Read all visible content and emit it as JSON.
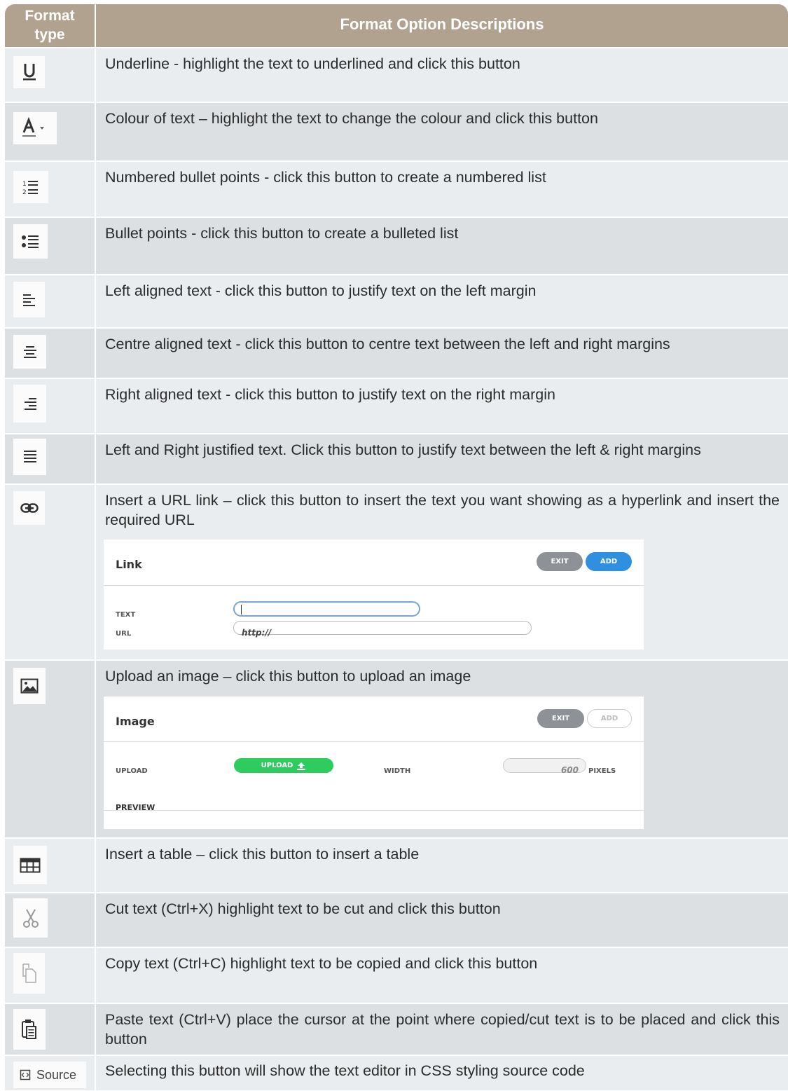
{
  "header": {
    "col1": "Format type",
    "col1_line1": "Format",
    "col1_line2": "type",
    "col2": "Format Option Descriptions"
  },
  "rows": [
    {
      "icon": "underline-icon",
      "description": "Underline - highlight the text to underlined and click this button"
    },
    {
      "icon": "text-colour-icon",
      "description": "Colour of text – highlight the text to change the colour and click this button"
    },
    {
      "icon": "numbered-list-icon",
      "description": "Numbered bullet points - click this button to create a numbered list"
    },
    {
      "icon": "bulleted-list-icon",
      "description": "Bullet points - click this button to create a bulleted list"
    },
    {
      "icon": "align-left-icon",
      "description": "Left aligned text - click this button to justify text on the left margin"
    },
    {
      "icon": "align-centre-icon",
      "description": "Centre aligned text - click this button to centre text between the left and right margins"
    },
    {
      "icon": "align-right-icon",
      "description": "Right aligned text - click this button to justify text on the right margin"
    },
    {
      "icon": "justify-icon",
      "description": "Left and Right justified text. Click this button to justify text between the left & right margins"
    },
    {
      "icon": "link-icon",
      "description": "Insert a URL link – click this button to insert the text you want showing as a hyperlink and insert the required URL"
    },
    {
      "icon": "image-icon",
      "description": "Upload an image – click this button to upload an image"
    },
    {
      "icon": "table-icon",
      "description": "Insert a table – click this button to insert a table"
    },
    {
      "icon": "cut-icon",
      "description": "Cut text (Ctrl+X) highlight text to be cut and click this button"
    },
    {
      "icon": "copy-icon",
      "description": "Copy text (Ctrl+C) highlight text to be copied and click this button"
    },
    {
      "icon": "paste-icon",
      "description": "Paste text (Ctrl+V) place the cursor at the point where copied/cut text is to be placed and click this button"
    },
    {
      "icon": "source-icon",
      "description": "Selecting this button will show the text editor in CSS styling source code"
    }
  ],
  "source_button_label": "Source",
  "link_dialog": {
    "title": "Link",
    "exit": "EXIT",
    "add": "ADD",
    "text_label": "TEXT",
    "text_value": "",
    "url_label": "URL",
    "url_value": "http://"
  },
  "image_dialog": {
    "title": "Image",
    "exit": "EXIT",
    "add": "ADD",
    "upload_label": "UPLOAD",
    "upload_button": "UPLOAD",
    "width_label": "WIDTH",
    "width_value": "600",
    "width_unit": "PIXELS",
    "preview_label": "PREVIEW"
  },
  "colors": {
    "header": "#b1a28f",
    "row_light": "#eaedef",
    "row_dark": "#dde0e3",
    "add_blue": "#2f8fe0",
    "upload_green": "#2ecc5e",
    "exit_grey": "#8e9296"
  }
}
